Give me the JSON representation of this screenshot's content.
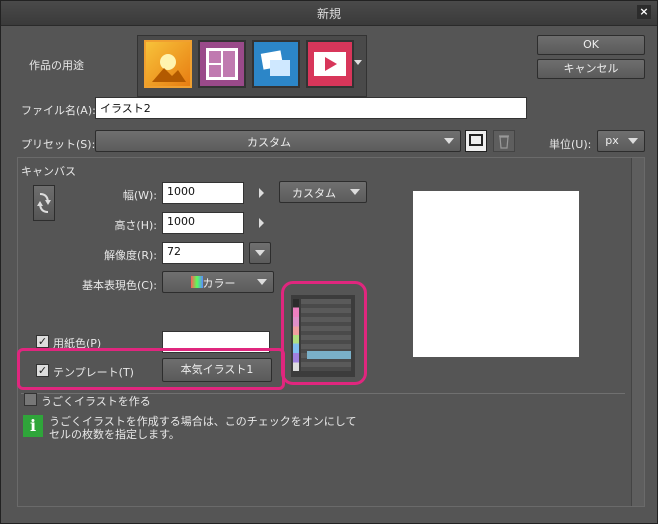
{
  "window": {
    "title": "新規",
    "close": "×"
  },
  "buttons": {
    "ok": "OK",
    "cancel": "キャンセル"
  },
  "usage": {
    "label": "作品の用途"
  },
  "filename": {
    "label": "ファイル名(A):",
    "value": "イラスト2"
  },
  "preset": {
    "label": "プリセット(S):",
    "value": "カスタム"
  },
  "unit": {
    "label": "単位(U):",
    "value": "px"
  },
  "canvas": {
    "group_label": "キャンバス",
    "width_label": "幅(W):",
    "width_value": "1000",
    "height_label": "高さ(H):",
    "height_value": "1000",
    "resolution_label": "解像度(R):",
    "resolution_value": "72",
    "size_preset": "カスタム",
    "color_mode_label": "基本表現色(C):",
    "color_mode_value": "カラー"
  },
  "paper": {
    "label": "用紙色(P)",
    "checked": true
  },
  "template": {
    "label": "テンプレート(T)",
    "checked": true,
    "value": "本気イラスト1"
  },
  "animation": {
    "label": "うごくイラストを作る",
    "checked": false,
    "info_line1": "うごくイラストを作成する場合は、このチェックをオンにして",
    "info_line2": "セルの枚数を指定します。",
    "info_icon": "i"
  },
  "colors": {
    "highlight": "#e0267e"
  }
}
